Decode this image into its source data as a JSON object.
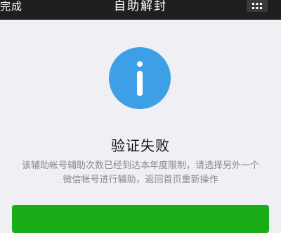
{
  "navbar": {
    "left_label": "完成",
    "title": "自助解封",
    "more_icon": "more-icon"
  },
  "result": {
    "icon": "info-icon",
    "icon_color": "#3d9fe6",
    "title": "验证失败",
    "description_line1": "该辅助帐号辅助次数已经到达本年度限制，请选择另外一个",
    "description_line2": "微信帐号进行辅助，返回首页重新操作"
  },
  "colors": {
    "navbar": "#1f1f1f",
    "background": "#efeff4",
    "primary_button": "#1aad19"
  }
}
